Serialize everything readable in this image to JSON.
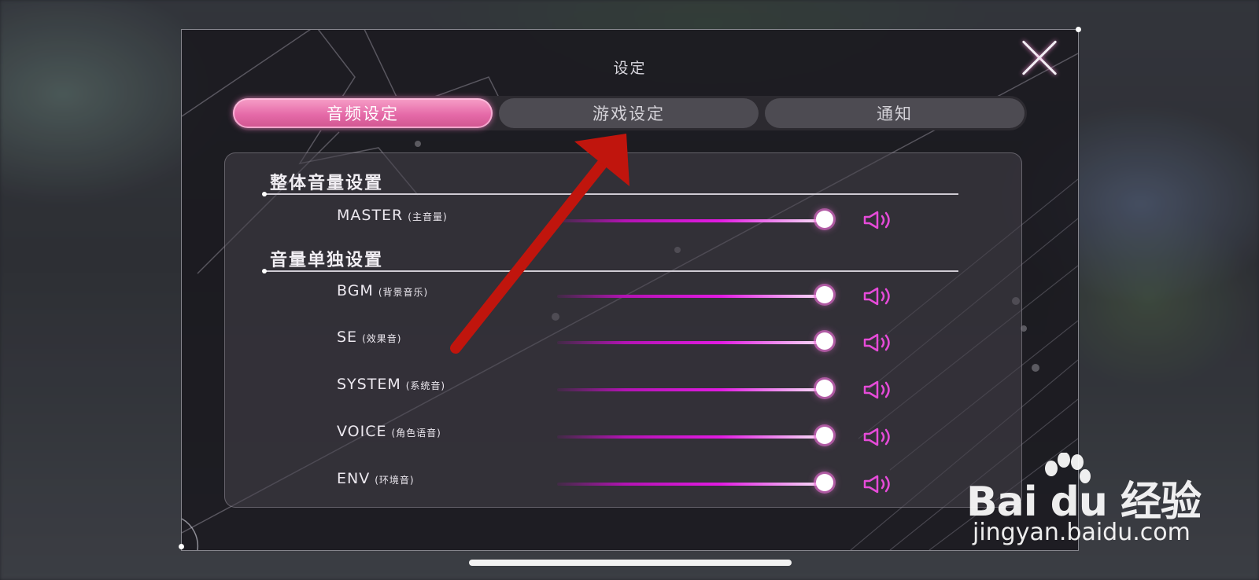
{
  "title": "设定",
  "close_icon": "close-x-icon",
  "tabs": [
    {
      "label": "音频设定",
      "active": true
    },
    {
      "label": "游戏设定",
      "active": false
    },
    {
      "label": "通知",
      "active": false
    }
  ],
  "sections": {
    "overall": {
      "title": "整体音量设置",
      "rows": [
        {
          "label": "MASTER",
          "sub": "(主音量)",
          "level": 1.0
        }
      ]
    },
    "individual": {
      "title": "音量单独设置",
      "rows": [
        {
          "label": "BGM",
          "sub": "(背景音乐)",
          "level": 1.0
        },
        {
          "label": "SE",
          "sub": "(效果音)",
          "level": 1.0
        },
        {
          "label": "SYSTEM",
          "sub": "(系统音)",
          "level": 1.0
        },
        {
          "label": "VOICE",
          "sub": "(角色语音)",
          "level": 1.0
        },
        {
          "label": "ENV",
          "sub": "(环境音)",
          "level": 1.0
        }
      ]
    }
  },
  "speaker_icon": "speaker-on-icon",
  "colors": {
    "accent": "#e56aa8",
    "slider": "#e21be2",
    "annotation_arrow": "#c0150d"
  },
  "watermark": {
    "brand": "Bai du 经验",
    "url": "jingyan.baidu.com"
  }
}
